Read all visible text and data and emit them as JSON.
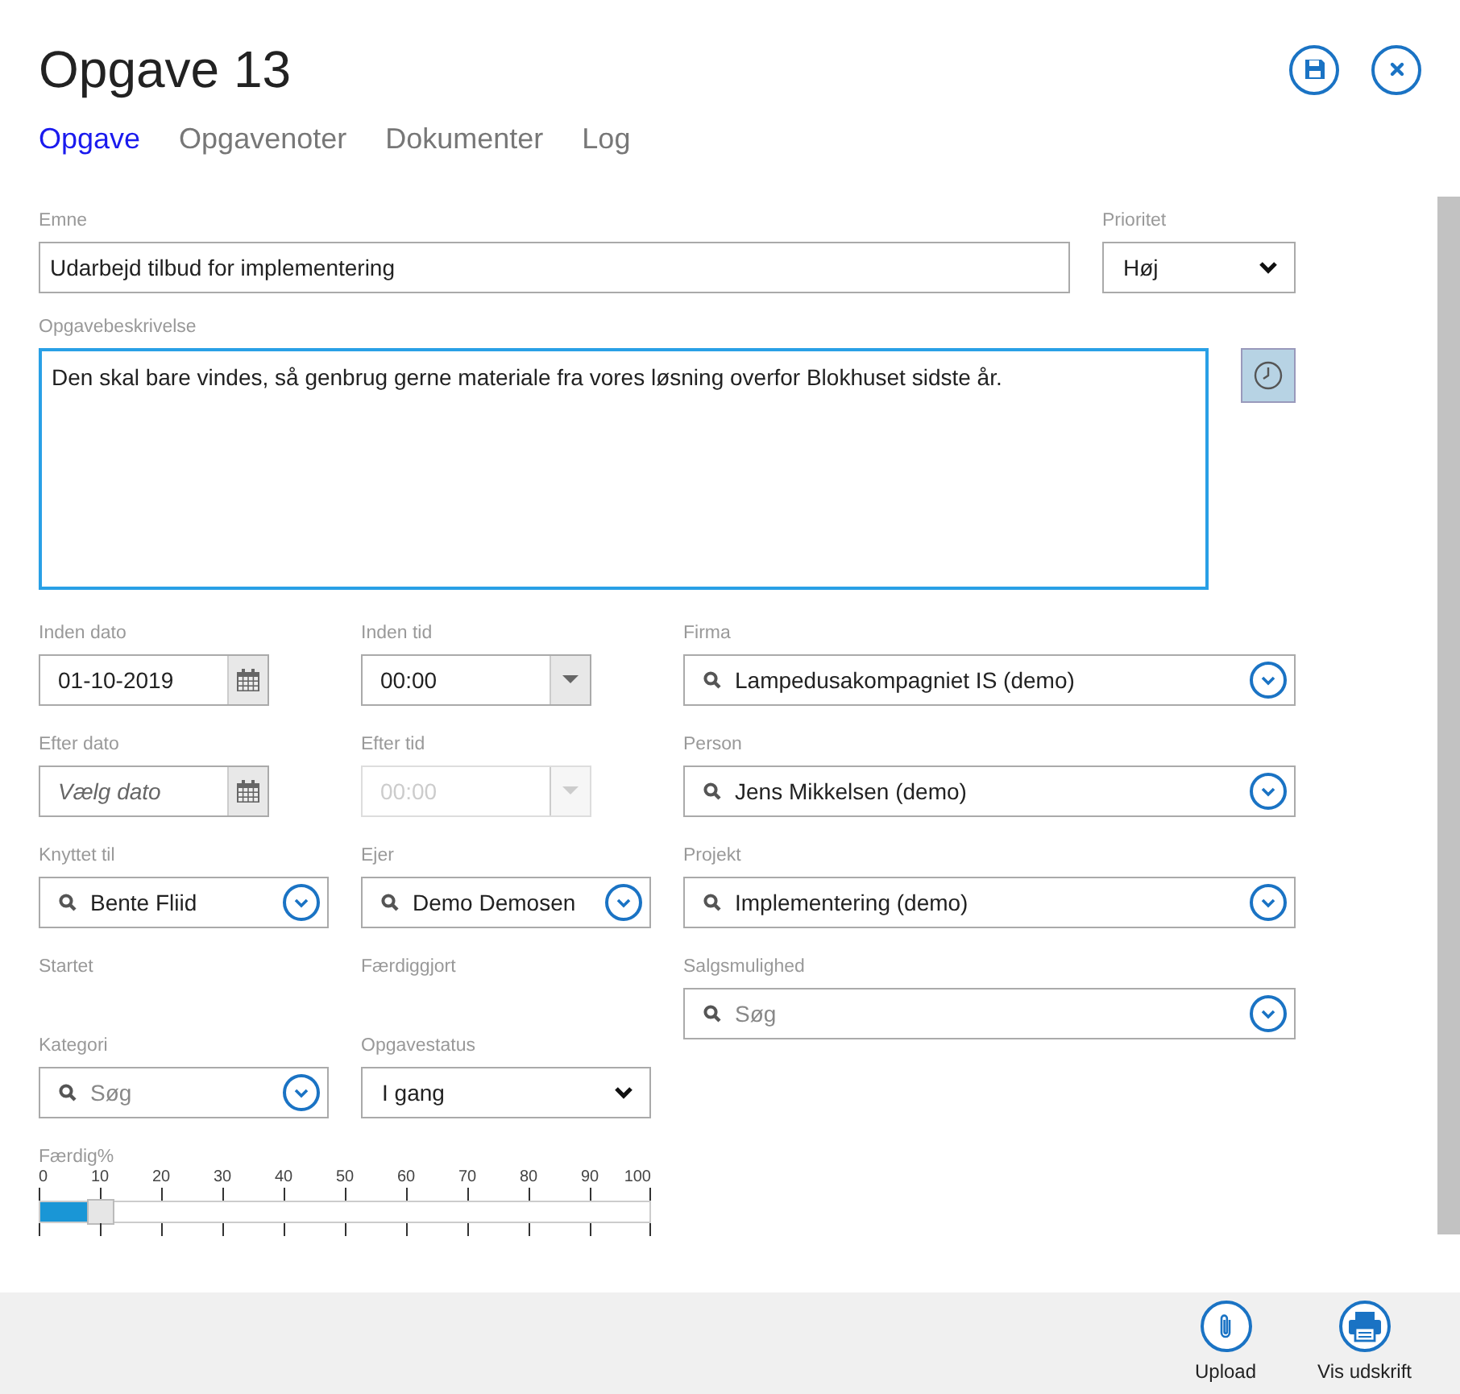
{
  "title": "Opgave 13",
  "actions": [
    {
      "kind": "save"
    },
    {
      "kind": "close"
    }
  ],
  "tabs": [
    {
      "label": "Opgave",
      "selected": true
    },
    {
      "label": "Opgavenoter",
      "selected": false
    },
    {
      "label": "Dokumenter",
      "selected": false
    },
    {
      "label": "Log",
      "selected": false
    }
  ],
  "subject": {
    "label": "Emne",
    "value": "Udarbejd tilbud for implementering"
  },
  "priority": {
    "label": "Prioritet",
    "value": "Høj"
  },
  "description": {
    "label": "Opgavebeskrivelse",
    "value": "Den skal bare vindes, så genbrug gerne materiale fra vores løsning overfor Blokhuset sidste år.",
    "focused": true
  },
  "left_rows": [
    [
      {
        "kind": "date",
        "label": "Inden dato",
        "value": "01-10-2019"
      },
      {
        "kind": "time",
        "label": "Inden tid",
        "value": "00:00",
        "disabled": false
      }
    ],
    [
      {
        "kind": "date",
        "label": "Efter dato",
        "placeholder": "Vælg dato"
      },
      {
        "kind": "time",
        "label": "Efter tid",
        "placeholder": "00:00",
        "disabled": true
      }
    ],
    [
      {
        "kind": "lookup",
        "label": "Knyttet til",
        "value": "Bente Fliid"
      },
      {
        "kind": "lookup",
        "label": "Ejer",
        "value": "Demo Demosen"
      }
    ],
    [
      {
        "kind": "label",
        "label": "Startet"
      },
      {
        "kind": "label",
        "label": "Færdiggjort"
      }
    ],
    [
      {
        "kind": "lookup",
        "label": "Kategori",
        "placeholder": "Søg"
      },
      {
        "kind": "select",
        "label": "Opgavestatus",
        "value": "I gang"
      }
    ]
  ],
  "right_fields": [
    {
      "label": "Firma",
      "value": "Lampedusakompagniet IS (demo)"
    },
    {
      "label": "Person",
      "value": "Jens Mikkelsen (demo)"
    },
    {
      "label": "Projekt",
      "value": "Implementering (demo)"
    },
    {
      "label": "Salgsmulighed",
      "placeholder": "Søg"
    }
  ],
  "progress": {
    "label": "Færdig%",
    "ticks": [
      "0",
      "10",
      "20",
      "30",
      "40",
      "50",
      "60",
      "70",
      "80",
      "90",
      "100"
    ],
    "level": 0.1
  },
  "footer_buttons": [
    {
      "kind": "upload",
      "label": "Upload"
    },
    {
      "kind": "print",
      "label": "Vis udskrift"
    }
  ]
}
